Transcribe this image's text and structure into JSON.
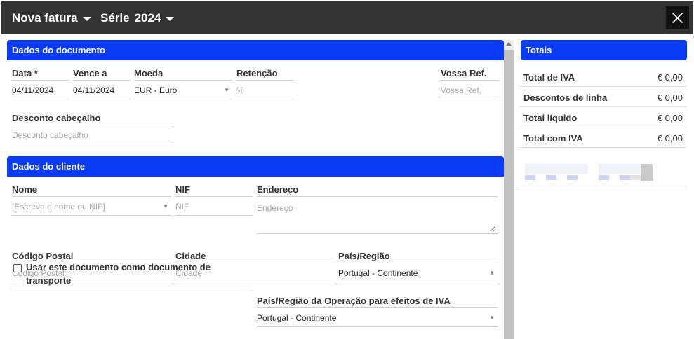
{
  "dialog": {
    "title": "Nova fatura",
    "series_label": "Série",
    "series_value": "2024"
  },
  "document_section": {
    "title": "Dados do documento",
    "date": {
      "label": "Data *",
      "value": "04/11/2024"
    },
    "due": {
      "label": "Vence a",
      "value": "04/11/2024"
    },
    "currency": {
      "label": "Moeda",
      "value": "EUR - Euro"
    },
    "retention": {
      "label": "Retenção",
      "placeholder": "%"
    },
    "your_ref": {
      "label": "Vossa Ref.",
      "placeholder": "Vossa Ref."
    },
    "header_discount": {
      "label": "Desconto cabeçalho",
      "placeholder": "Desconto cabeçalho"
    }
  },
  "client_section": {
    "title": "Dados do cliente",
    "name": {
      "label": "Nome",
      "placeholder": "[Escreva o nome ou NIF]"
    },
    "nif": {
      "label": "NIF",
      "placeholder": "NIF"
    },
    "address": {
      "label": "Endereço",
      "placeholder": "Endereço"
    },
    "postal_code": {
      "label": "Código Postal",
      "placeholder": "Código Postal"
    },
    "city": {
      "label": "Cidade",
      "placeholder": "Cidade"
    },
    "country": {
      "label": "País/Região",
      "value": "Portugal - Continente"
    },
    "transport_checkbox": {
      "label": "Usar este documento como documento de transporte",
      "checked": false
    },
    "vat_country": {
      "label": "País/Região da Operação para efeitos de IVA",
      "value": "Portugal - Continente"
    }
  },
  "totals": {
    "title": "Totais",
    "rows": [
      {
        "label": "Total de IVA",
        "value": "€ 0,00"
      },
      {
        "label": "Descontos de linha",
        "value": "€ 0,00"
      },
      {
        "label": "Total líquido",
        "value": "€ 0,00"
      },
      {
        "label": "Total com IVA",
        "value": "€ 0,00"
      }
    ]
  },
  "colors": {
    "topbar": "#333333",
    "section_header": "#0a3cf5",
    "close_button": "#111111"
  },
  "icons": {
    "dropdown": "caret-down-icon",
    "close": "close-icon",
    "select_arrow": "chevron-down-icon"
  }
}
